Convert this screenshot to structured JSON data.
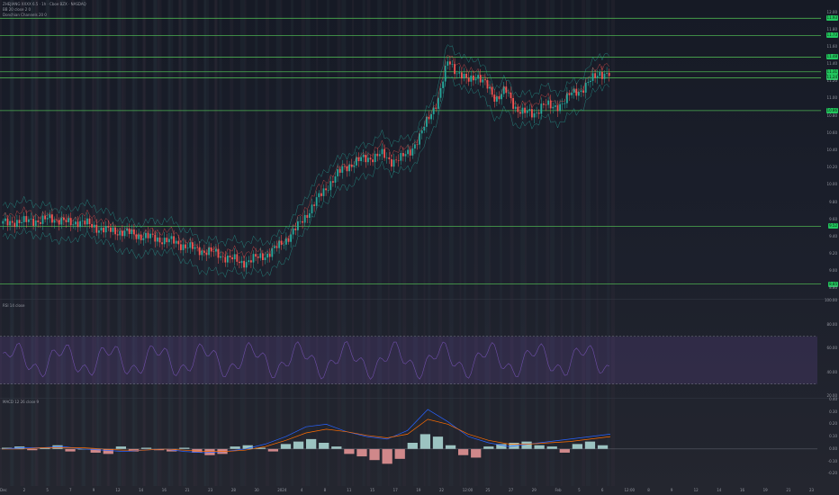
{
  "colors": {
    "bg": "#131722",
    "up": "#26a69a",
    "down": "#ef5350",
    "level_line": "#4caf50",
    "level_badge": "#22c55e",
    "rsi_band": "#7e57c2"
  },
  "header": {
    "line1": "ZHEJIANG XXXX 6.5 · 1h · Cboe BZX · NASDAQ",
    "line2": "BB 20 close 2 0",
    "line3": "Donchian Channels 20 0"
  },
  "rsi_panel": {
    "legend": "RSI 14 close"
  },
  "macd_panel": {
    "legend": "MACD 12 26 close 9"
  },
  "chart_data": [
    {
      "type": "candlestick",
      "title": "",
      "ylim": [
        8.7,
        12.1
      ],
      "y_ticks": [
        "12.00",
        "11.80",
        "11.60",
        "11.40",
        "11.20",
        "11.00",
        "10.80",
        "10.60",
        "10.40",
        "10.20",
        "10.00",
        "9.80",
        "9.60",
        "9.40",
        "9.20",
        "9.00",
        "8.80"
      ],
      "levels": [
        {
          "value": 11.93,
          "label": "11.93"
        },
        {
          "value": 11.73,
          "label": "11.73"
        },
        {
          "value": 11.48,
          "label": "11.48"
        },
        {
          "value": 11.31,
          "label": "11.31"
        },
        {
          "value": 11.24,
          "label": "11.24"
        },
        {
          "value": 10.86,
          "label": "10.86"
        },
        {
          "value": 9.52,
          "label": "9.52"
        },
        {
          "value": 8.85,
          "label": "8.85"
        }
      ],
      "x_labels": [
        "Dec",
        "2",
        "5",
        "7",
        "9",
        "12",
        "14",
        "16",
        "21",
        "23",
        "28",
        "30",
        "2024",
        "4",
        "8",
        "11",
        "15",
        "17",
        "19",
        "22",
        "12:00",
        "25",
        "27",
        "29",
        "Feb",
        "5",
        "6",
        "12:00",
        "8",
        "9",
        "12",
        "14",
        "16",
        "19",
        "21",
        "23"
      ],
      "close_path": [
        9.55,
        9.58,
        9.56,
        9.6,
        9.57,
        9.62,
        9.59,
        9.55,
        9.58,
        9.54,
        9.5,
        9.47,
        9.46,
        9.45,
        9.42,
        9.4,
        9.38,
        9.36,
        9.34,
        9.3,
        9.26,
        9.24,
        9.22,
        9.18,
        9.15,
        9.1,
        9.12,
        9.16,
        9.2,
        9.28,
        9.38,
        9.5,
        9.65,
        9.8,
        9.95,
        10.08,
        10.2,
        10.25,
        10.3,
        10.32,
        10.35,
        10.28,
        10.3,
        10.4,
        10.55,
        10.8,
        11.0,
        11.45,
        11.3,
        11.2,
        11.28,
        11.15,
        11.0,
        11.1,
        10.9,
        10.85,
        10.8,
        10.95,
        10.88,
        10.95,
        11.05,
        11.1,
        11.2,
        11.3,
        11.28
      ]
    },
    {
      "type": "line",
      "title": "",
      "ylim": [
        20,
        100
      ],
      "y_ticks": [
        "100.00",
        "80.00",
        "60.00",
        "40.00",
        "20.00"
      ],
      "band": [
        30,
        70
      ]
    },
    {
      "type": "bar",
      "title": "",
      "ylim": [
        -0.3,
        0.4
      ],
      "y_ticks": [
        "0.40",
        "0.30",
        "0.20",
        "0.10",
        "0.00",
        "-0.10",
        "-0.20"
      ],
      "histogram": [
        0.01,
        0.02,
        -0.01,
        0.01,
        0.03,
        -0.02,
        0.0,
        -0.03,
        -0.04,
        0.02,
        -0.02,
        0.01,
        -0.01,
        -0.02,
        0.01,
        -0.03,
        -0.05,
        -0.04,
        0.02,
        0.03,
        0.01,
        -0.02,
        0.04,
        0.06,
        0.08,
        0.05,
        0.02,
        -0.04,
        -0.06,
        -0.09,
        -0.12,
        -0.08,
        0.05,
        0.12,
        0.1,
        0.03,
        -0.05,
        -0.07,
        0.02,
        0.04,
        0.05,
        0.06,
        0.03,
        0.02,
        -0.03,
        0.04,
        0.06,
        0.03
      ],
      "macd": [
        0.0,
        0.01,
        0.01,
        0.02,
        0.0,
        -0.01,
        -0.02,
        -0.01,
        0.0,
        -0.02,
        -0.03,
        -0.02,
        0.0,
        0.04,
        0.1,
        0.18,
        0.2,
        0.14,
        0.1,
        0.08,
        0.15,
        0.32,
        0.22,
        0.1,
        0.05,
        0.02,
        0.04,
        0.06,
        0.08,
        0.1,
        0.12
      ],
      "signal": [
        0.0,
        0.0,
        0.01,
        0.01,
        0.01,
        0.0,
        -0.01,
        -0.01,
        0.0,
        -0.01,
        -0.02,
        -0.02,
        -0.01,
        0.02,
        0.07,
        0.13,
        0.16,
        0.14,
        0.11,
        0.09,
        0.12,
        0.24,
        0.2,
        0.12,
        0.07,
        0.04,
        0.04,
        0.05,
        0.06,
        0.08,
        0.1
      ]
    }
  ]
}
